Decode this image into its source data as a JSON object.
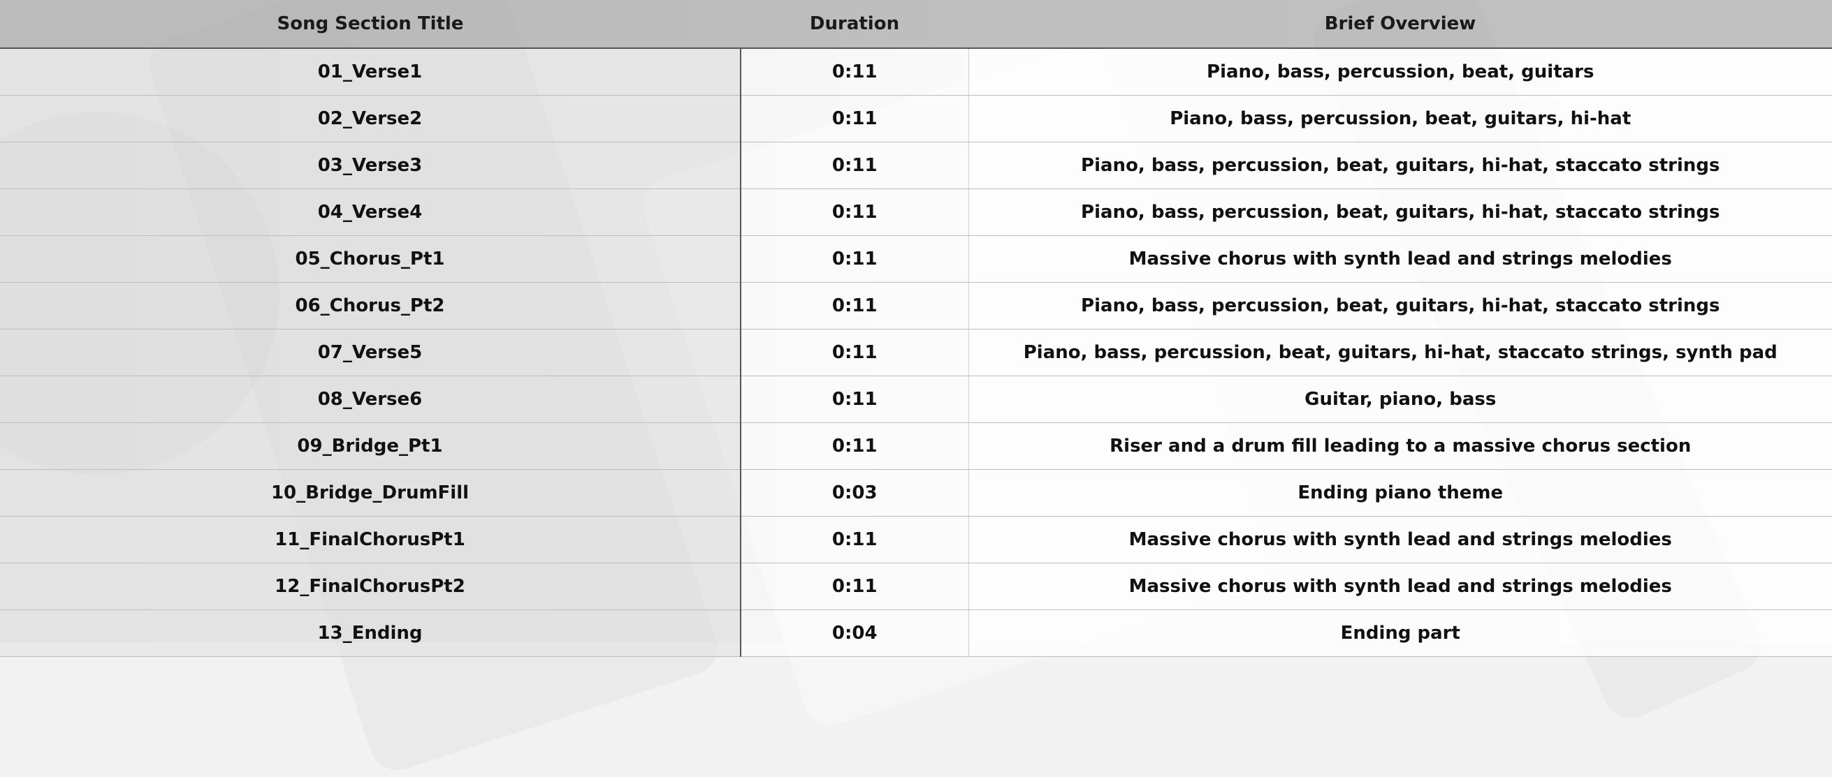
{
  "table": {
    "headers": [
      "Song Section Title",
      "Duration",
      "Brief Overview"
    ],
    "rows": [
      [
        "01_Verse1",
        "0:11",
        "Piano, bass, percussion, beat, guitars"
      ],
      [
        "02_Verse2",
        "0:11",
        "Piano, bass, percussion, beat, guitars, hi-hat"
      ],
      [
        "03_Verse3",
        "0:11",
        "Piano, bass, percussion, beat, guitars, hi-hat, staccato strings"
      ],
      [
        "04_Verse4",
        "0:11",
        "Piano, bass, percussion, beat, guitars, hi-hat, staccato strings"
      ],
      [
        "05_Chorus_Pt1",
        "0:11",
        "Massive chorus with synth lead and strings melodies"
      ],
      [
        "06_Chorus_Pt2",
        "0:11",
        "Piano, bass, percussion, beat, guitars, hi-hat, staccato strings"
      ],
      [
        "07_Verse5",
        "0:11",
        "Piano, bass, percussion, beat, guitars, hi-hat, staccato strings, synth pad"
      ],
      [
        "08_Verse6",
        "0:11",
        "Guitar, piano, bass"
      ],
      [
        "09_Bridge_Pt1",
        "0:11",
        "Riser and a drum fill leading to a massive chorus section"
      ],
      [
        "10_Bridge_DrumFill",
        "0:03",
        "Ending piano theme"
      ],
      [
        "11_FinalChorusPt1",
        "0:11",
        "Massive chorus with synth lead and strings melodies"
      ],
      [
        "12_FinalChorusPt2",
        "0:11",
        "Massive chorus with synth lead and strings melodies"
      ],
      [
        "13_Ending",
        "0:04",
        "Ending part"
      ]
    ]
  }
}
